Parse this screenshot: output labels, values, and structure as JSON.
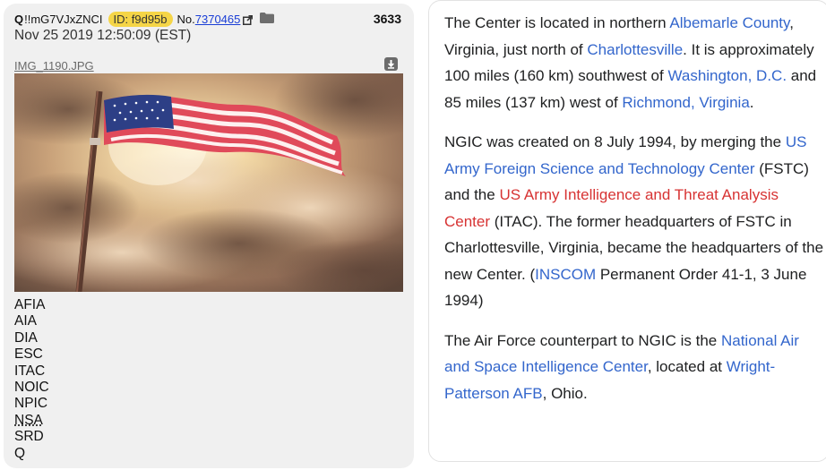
{
  "post": {
    "name": "Q",
    "tripcode": "!!mG7VJxZNCI",
    "id_badge": "ID: f9d95b",
    "number_prefix": "No.",
    "number": "7370465",
    "reply_count": "3633",
    "date": "Nov 25 2019 12:50:09 (EST)",
    "filename": "IMG_1190.JPG",
    "acronyms": [
      "AFIA",
      "AIA",
      "DIA",
      "ESC",
      "ITAC",
      "NOIC",
      "NPIC",
      "NSA",
      "SRD",
      "Q"
    ]
  },
  "wiki": {
    "p1": {
      "t1": "The Center is located in northern ",
      "l1": "Albemarle County",
      "t2": ", Virginia, just north of ",
      "l2": "Charlottesville",
      "t3": ". It is approximately 100 miles (160 km) southwest of ",
      "l3": "Washington, D.C.",
      "t4": " and 85 miles (137 km) west of ",
      "l4": "Richmond, Virginia",
      "t5": "."
    },
    "p2": {
      "t1": "NGIC was created on 8 July 1994, by merging the ",
      "l1": "US Army Foreign Science and Technology Center",
      "t2": " (FSTC) and the ",
      "l2": "US Army Intelligence and Threat Analysis Center",
      "t3": " (ITAC). The former headquarters of FSTC in Charlottesville, Virginia, became the headquarters of the new Center. (",
      "l3": "INSCOM",
      "t4": " Permanent Order 41-1, 3 June 1994)"
    },
    "p3": {
      "t1": "The Air Force counterpart to NGIC is the ",
      "l1": "National Air and Space Intelligence Center",
      "t2": ", located at ",
      "l2": "Wright-Patterson AFB",
      "t3": ", Ohio."
    }
  },
  "colors": {
    "link": "#3366cc",
    "redlink": "#d73333",
    "id_badge": "#f5d547",
    "post_bg": "#f0f0f0"
  },
  "icons": [
    "external-link-icon",
    "folder-icon",
    "download-icon"
  ]
}
